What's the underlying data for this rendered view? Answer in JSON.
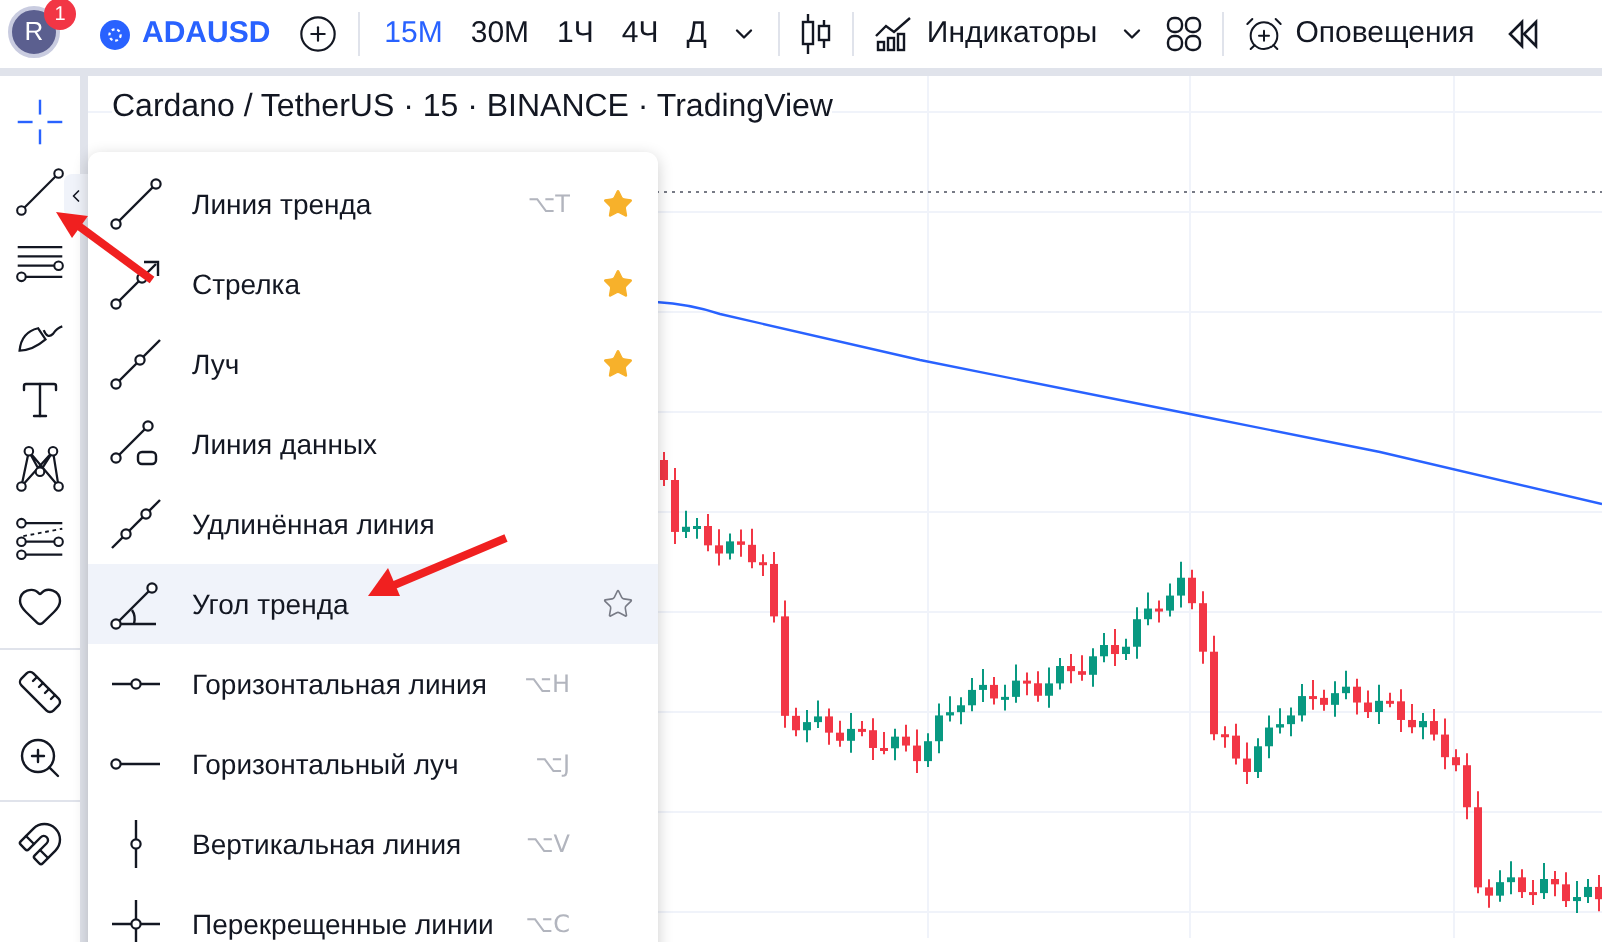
{
  "topbar": {
    "avatar": "R",
    "badge": "1",
    "symbol": "ADAUSD",
    "intervals": [
      {
        "label": "15M",
        "selected": true
      },
      {
        "label": "30M",
        "selected": false
      },
      {
        "label": "1Ч",
        "selected": false
      },
      {
        "label": "4Ч",
        "selected": false
      },
      {
        "label": "Д",
        "selected": false
      }
    ],
    "indicators": "Индикаторы",
    "alerts": "Оповещения"
  },
  "chart": {
    "title": "Cardano / TetherUS · 15 · BINANCE · TradingView"
  },
  "toolbar": [
    {
      "kind": "crosshair"
    },
    {
      "kind": "trend"
    },
    {
      "kind": "fib"
    },
    {
      "kind": "brush"
    },
    {
      "kind": "text"
    },
    {
      "kind": "pattern"
    },
    {
      "kind": "forecast"
    },
    {
      "kind": "heart"
    },
    {
      "kind": "ruler"
    },
    {
      "kind": "zoom"
    },
    {
      "kind": "magnet"
    }
  ],
  "menu": [
    {
      "kind": "trend",
      "label": "Линия тренда",
      "shortcut": "⌥T",
      "favorite": true,
      "selected": false
    },
    {
      "kind": "arrow",
      "label": "Стрелка",
      "favorite": true,
      "selected": false
    },
    {
      "kind": "ray",
      "label": "Луч",
      "favorite": true,
      "selected": false
    },
    {
      "kind": "data",
      "label": "Линия данных",
      "favorite": false,
      "selected": false
    },
    {
      "kind": "extended",
      "label": "Удлинённая линия",
      "favorite": false,
      "selected": false
    },
    {
      "kind": "angle",
      "label": "Угол тренда",
      "favorite": false,
      "selected": true
    },
    {
      "kind": "hline",
      "label": "Горизонтальная линия",
      "shortcut": "⌥H",
      "favorite": false,
      "selected": false
    },
    {
      "kind": "hray",
      "label": "Горизонтальный луч",
      "shortcut": "⌥J",
      "favorite": false,
      "selected": false
    },
    {
      "kind": "vline",
      "label": "Вертикальная линия",
      "shortcut": "⌥V",
      "favorite": false,
      "selected": false
    },
    {
      "kind": "cross",
      "label": "Перекрещенные линии",
      "shortcut": "⌥C",
      "favorite": false,
      "selected": false
    }
  ]
}
